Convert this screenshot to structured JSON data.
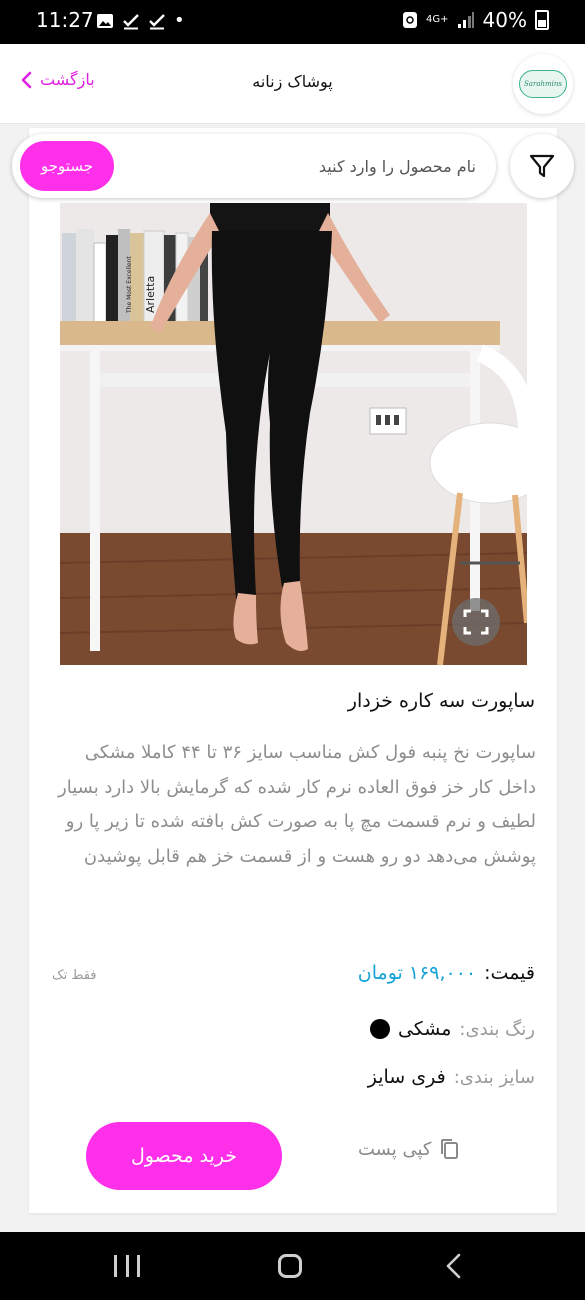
{
  "status_bar": {
    "time": "11:27",
    "network": "4G+",
    "battery": "40%"
  },
  "header": {
    "back_label": "بازگشت",
    "title": "پوشاک زنانه",
    "logo_text": "Sarahmins"
  },
  "search": {
    "placeholder": "نام محصول را وارد کنید",
    "button_label": "جستوجو"
  },
  "product": {
    "book_spines": [
      "Arletta",
      "The Most Excellent"
    ],
    "title": "ساپورت سه کاره خزدار",
    "description": "ساپورت نخ پنبه فول کش مناسب سایز ۳۶ تا ۴۴ کاملا مشکی داخل کار خز فوق العاده نرم کار شده که گرمایش بالا دارد بسیار لطیف و نرم قسمت مچ پا به صورت کش بافته شده تا زیر پا رو پوشش می‌دهد دو رو هست و از قسمت خز هم قابل پوشیدن",
    "price_label": "قیمت:",
    "price_value": "۱۶۹,۰۰۰ تومان",
    "single_note": "فقط تک",
    "color_label": "رنگ بندی:",
    "color_value": "مشکی",
    "color_hex": "#000000",
    "size_label": "سایز بندی:",
    "size_value": "فری سایز",
    "copy_label": "کپی پست",
    "buy_label": "خرید محصول"
  },
  "colors": {
    "accent": "#ff2fea",
    "price": "#16a3d8",
    "back_link": "#e020e0"
  }
}
